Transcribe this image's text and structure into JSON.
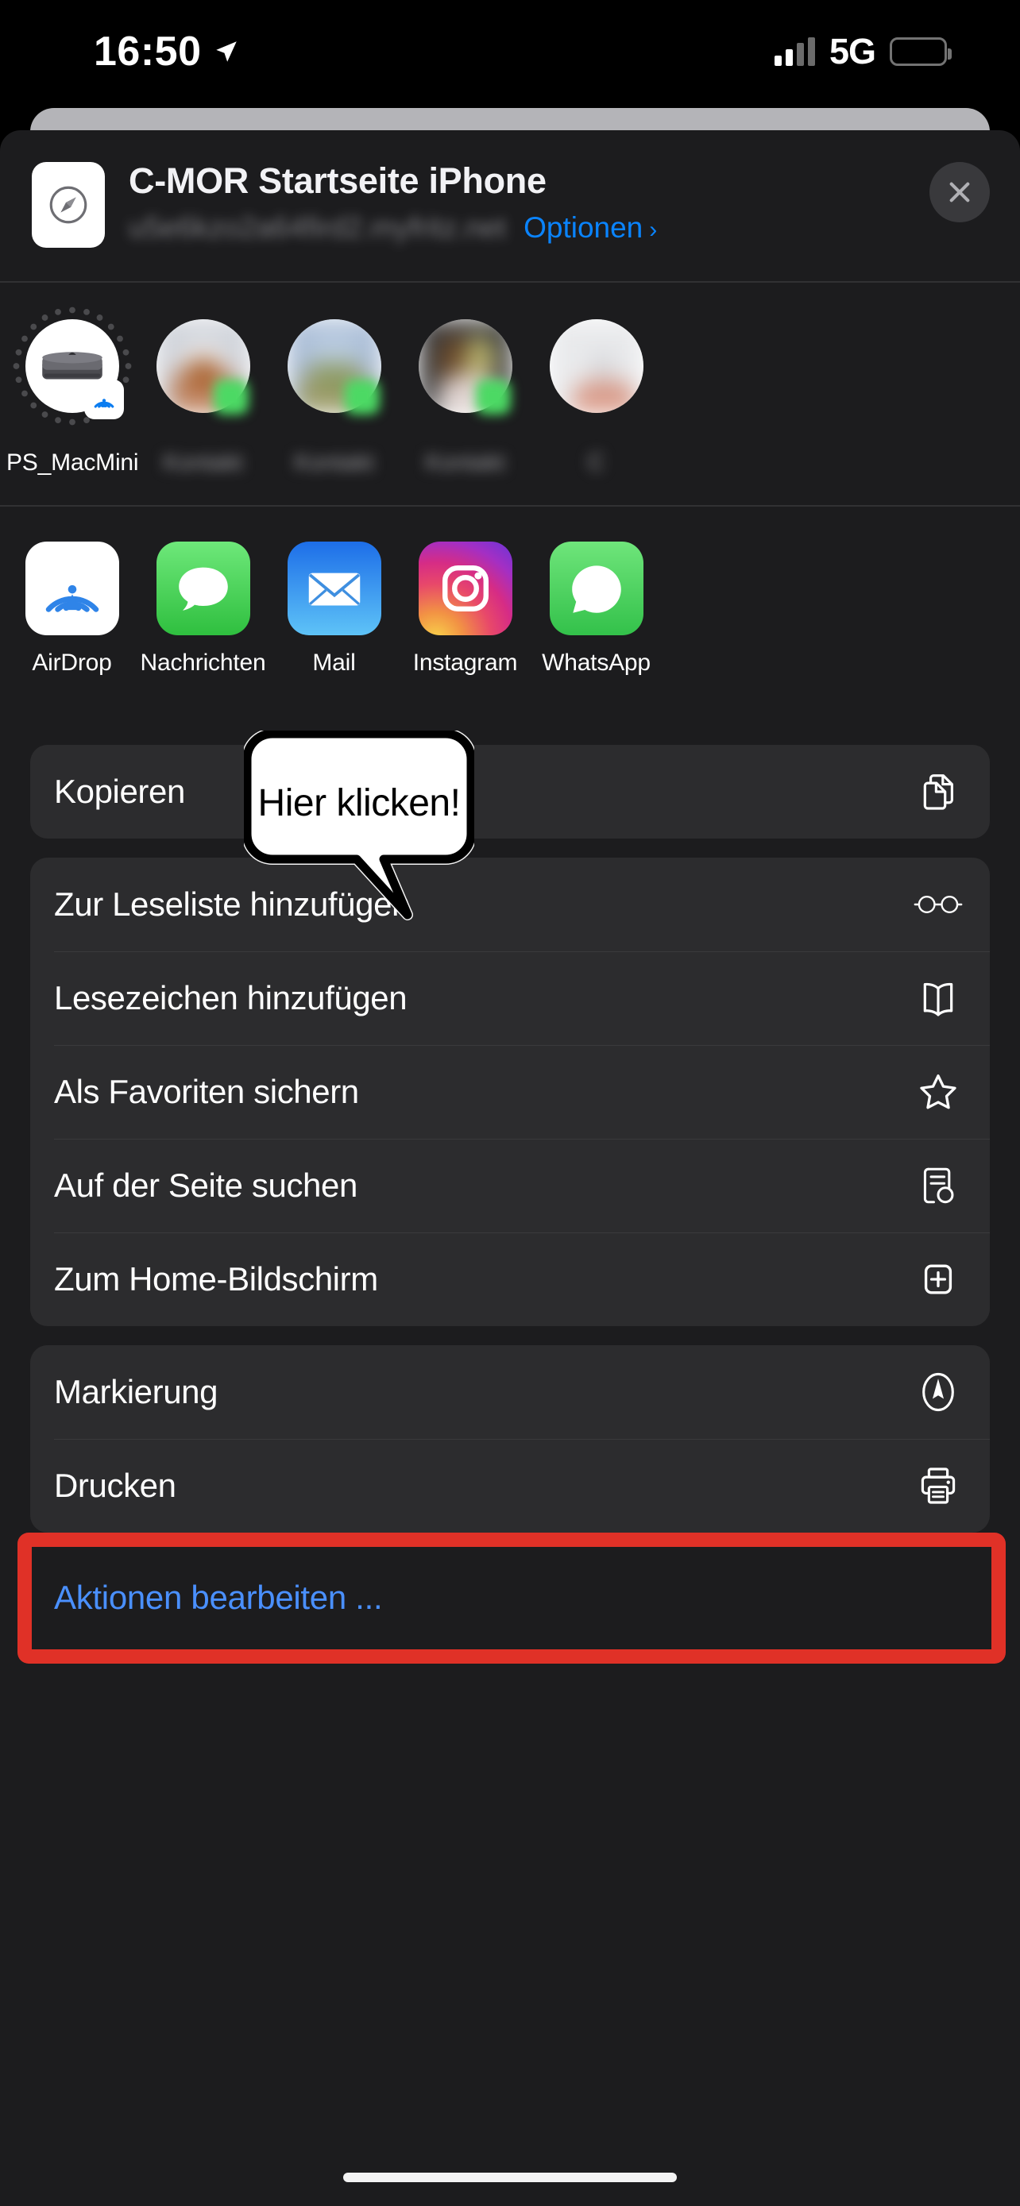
{
  "status_bar": {
    "time": "16:50",
    "location_icon": "location-arrow-icon",
    "network": "5G",
    "signal_icon": "cellular-bars-icon",
    "battery_icon": "battery-icon"
  },
  "share_sheet": {
    "header": {
      "app_icon": "safari-compass-icon",
      "title": "C-MOR Startseite iPhone",
      "url": "u5e6kzo2a64fird2.myfritz.net",
      "options_label": "Optionen",
      "options_chevron": "chevron-right-icon",
      "close_icon": "close-x-icon"
    },
    "airdrop_contacts": [
      {
        "name": "PS_MacMini",
        "icon": "mac-mini-icon",
        "badge": "airdrop-badge-icon",
        "blurred": false
      },
      {
        "name": "",
        "icon": "contact-photo",
        "badge": "messages-badge",
        "blurred": true
      },
      {
        "name": "",
        "icon": "contact-photo",
        "badge": "messages-badge",
        "blurred": true
      },
      {
        "name": "",
        "icon": "contact-photo",
        "badge": "messages-badge",
        "blurred": true
      },
      {
        "name": "",
        "icon": "contact-photo",
        "badge": "",
        "blurred": true
      }
    ],
    "apps": [
      {
        "label": "AirDrop",
        "icon": "airdrop-icon"
      },
      {
        "label": "Nachrichten",
        "icon": "messages-icon"
      },
      {
        "label": "Mail",
        "icon": "mail-icon"
      },
      {
        "label": "Instagram",
        "icon": "instagram-icon"
      },
      {
        "label": "WhatsApp",
        "icon": "whatsapp-icon"
      }
    ],
    "action_groups": [
      {
        "rows": [
          {
            "label": "Kopieren",
            "icon": "copy-icon"
          }
        ]
      },
      {
        "rows": [
          {
            "label": "Zur Leseliste hinzufügen",
            "icon": "glasses-icon"
          },
          {
            "label": "Lesezeichen hinzufügen",
            "icon": "book-icon"
          },
          {
            "label": "Als Favoriten sichern",
            "icon": "star-icon"
          },
          {
            "label": "Auf der Seite suchen",
            "icon": "find-on-page-icon"
          },
          {
            "label": "Zum Home-Bildschirm",
            "icon": "add-to-home-icon",
            "highlighted": true
          }
        ]
      },
      {
        "rows": [
          {
            "label": "Markierung",
            "icon": "markup-pen-icon"
          },
          {
            "label": "Drucken",
            "icon": "printer-icon"
          }
        ]
      }
    ],
    "edit_actions_label": "Aktionen bearbeiten ..."
  },
  "annotation": {
    "bubble_text": "Hier klicken!",
    "highlight_color": "#e03127",
    "bubble_fill": "#ffffff",
    "bubble_stroke": "#000000"
  },
  "colors": {
    "sheet_bg": "#1c1c1e",
    "group_bg": "#2c2c2e",
    "accent_blue": "#0a84ff",
    "link_blue": "#4a90ff",
    "text_primary": "#ffffff",
    "text_secondary": "#8e8e93"
  }
}
